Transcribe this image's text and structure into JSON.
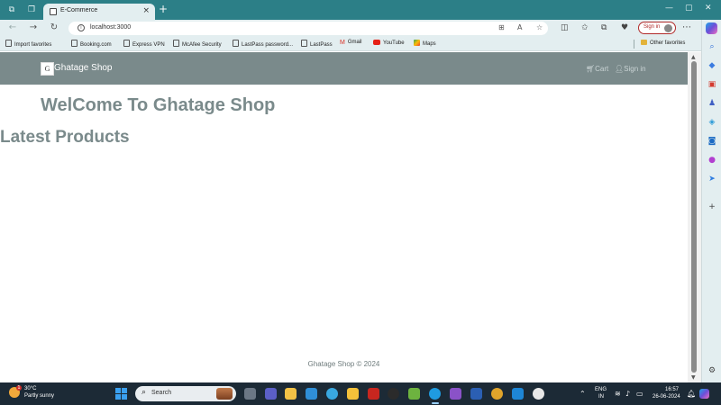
{
  "browser": {
    "tab_title": "E-Commerce",
    "address": "localhost:3000",
    "signin_label": "Sign in",
    "bookmarks": [
      {
        "label": "Import favorites",
        "icon": "import-icon"
      },
      {
        "label": "Booking.com",
        "icon": "page-icon"
      },
      {
        "label": "Express VPN",
        "icon": "page-icon"
      },
      {
        "label": "McAfee Security",
        "icon": "page-icon"
      },
      {
        "label": "LastPass password...",
        "icon": "page-icon"
      },
      {
        "label": "LastPass",
        "icon": "page-icon"
      },
      {
        "label": "Gmail",
        "icon": "gmail-icon"
      },
      {
        "label": "YouTube",
        "icon": "youtube-icon"
      },
      {
        "label": "Maps",
        "icon": "maps-icon"
      }
    ],
    "other_favorites": "Other favorites"
  },
  "site": {
    "brand": "Ghatage Shop",
    "logo_letter": "G",
    "nav": {
      "cart": "Cart",
      "signin": "Sign in"
    },
    "welcome": "WelCome To Ghatage Shop",
    "section_title": "Latest Products",
    "footer": "Ghatage Shop © 2024",
    "colors": {
      "navbar": "#7a8a8b",
      "heading": "#7a8a8b"
    }
  },
  "taskbar": {
    "weather_temp": "30°C",
    "weather_desc": "Partly sunny",
    "weather_badge": "1",
    "search_label": "Search",
    "lang_top": "ENG",
    "lang_bottom": "IN",
    "time": "16:57",
    "date": "26-06-2024"
  }
}
